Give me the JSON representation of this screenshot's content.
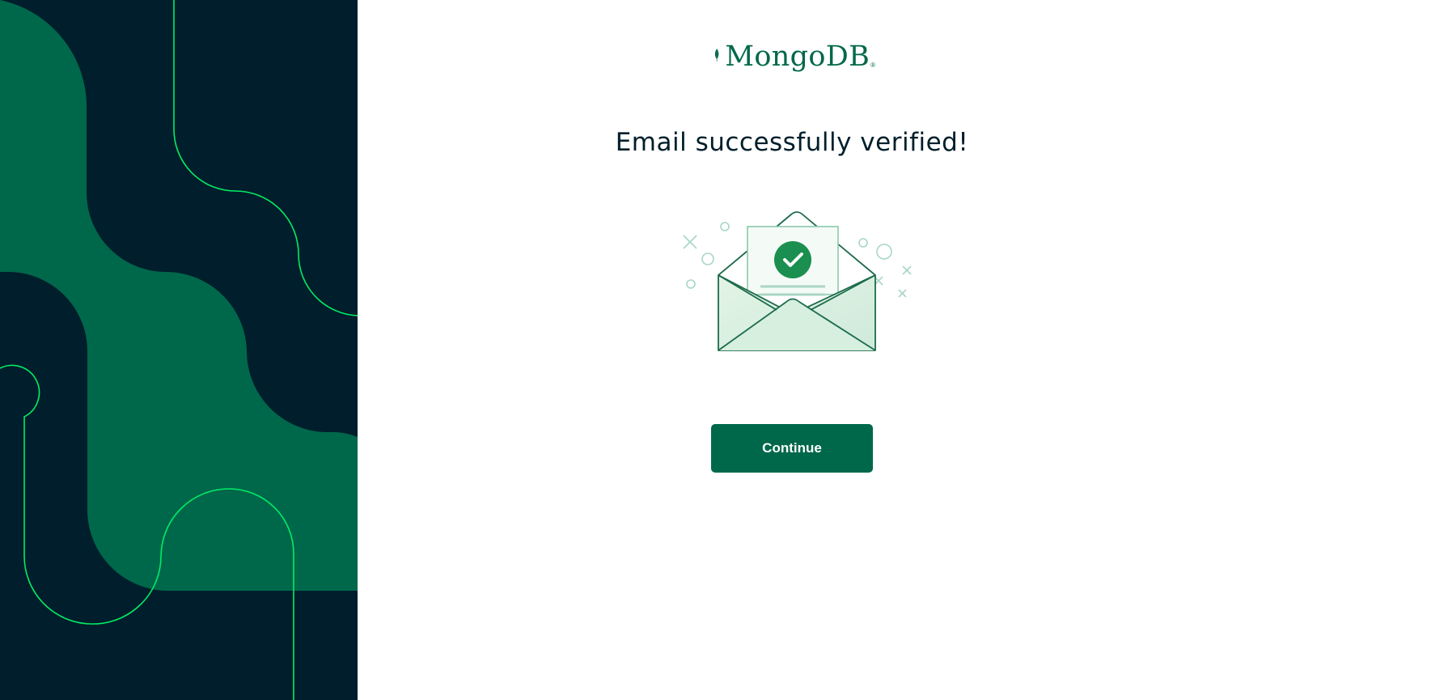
{
  "brand": {
    "name": "MongoDB",
    "registered_mark": "®",
    "color": "#00684a"
  },
  "main": {
    "title": "Email successfully verified!",
    "illustration_icon": "envelope-with-check-icon",
    "continue_label": "Continue"
  },
  "theme": {
    "panel_dark": "#001e2b",
    "panel_green": "#00684a",
    "accent_line": "#00ed64",
    "button_color": "#00684a",
    "text_color": "#001e2b"
  }
}
